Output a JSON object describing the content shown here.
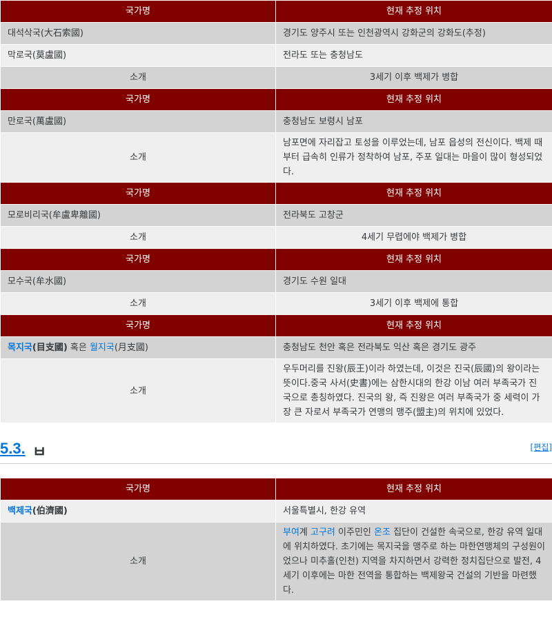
{
  "hdr": {
    "country": "국가명",
    "location": "현재 추정 위치"
  },
  "intro_label": "소개",
  "t1": [
    {
      "name": "대석삭국(大石索國)",
      "location": "경기도 양주시 또는 인천광역시 강화군의 강화도(추정)"
    },
    {
      "name": "막로국(莫盧國)",
      "location": "전라도 또는 충청남도",
      "intro": "3세기 이후 백제가 병합"
    },
    {
      "name": "만로국(萬盧國)",
      "location": "충청남도 보령시 남포",
      "intro": "남포면에 자리잡고 토성을 이루었는데, 남포 읍성의 전신이다. 백제 때부터 급속히 인류가 정착하여 남포, 주포 일대는 마을이 많이 형성되었다."
    },
    {
      "name": "모로비리국(牟盧卑離國)",
      "location": "전라북도 고창군",
      "intro": "4세기 무렵에야 백제가 병합"
    },
    {
      "name": "모수국(牟水國)",
      "location": "경기도 수원 일대",
      "intro": "3세기 이후 백제에 통합"
    },
    {
      "name_link1": "목지국",
      "name_hanja1": "(目支國)",
      "name_mid": " 혹은 ",
      "name_link2": "월지국",
      "name_hanja2": "(月支國)",
      "location": "충청남도 천안 혹은 전라북도 익산 혹은 경기도 광주",
      "intro": "우두머리를 진왕(辰王)이라 하였는데, 이것은 진국(辰國)의 왕이라는 뜻이다.중국 사서(史書)에는 삼한시대의 한강 이남 여러 부족국가 진국으로 총칭하였다. 진국의 왕, 즉 진왕은 여러 부족국가 중 세력이 가장 큰 자로서 부족국가 연맹의 맹주(盟主)의 위치에 있었다."
    }
  ],
  "section": {
    "number": "5.3.",
    "title": "ㅂ",
    "edit": "[편집]"
  },
  "t2": {
    "name_link": "백제국",
    "name_hanja": "(伯濟國)",
    "location": "서울특별시, 한강 유역",
    "intro_l1": "부여",
    "intro_t1": "계 ",
    "intro_l2": "고구려",
    "intro_t2": " 이주민인 ",
    "intro_l3": "온조",
    "intro_t3": " 집단이 건설한 속국으로, 한강 유역 일대에 위치하였다. 초기에는 목지국을 맹주로 하는 마한연맹체의 구성원이었으나 미추홀(인천) 지역을 차지하면서 강력한 정치집단으로 발전, 4세기 이후에는 마한 전역을 통합하는 백제왕국 건설의 기반을 마련했다."
  }
}
